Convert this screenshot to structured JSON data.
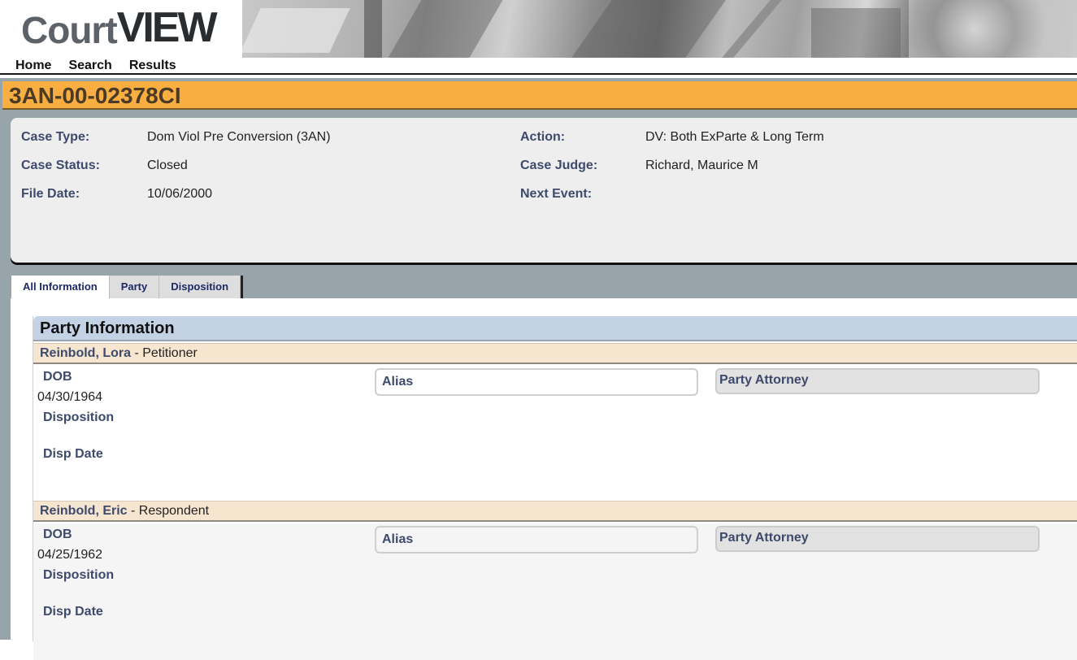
{
  "header": {
    "logo_part1": "Court",
    "logo_part2": "VIEW",
    "nav": [
      "Home",
      "Search",
      "Results"
    ]
  },
  "case": {
    "number": "3AN-00-02378CI",
    "left_fields": [
      {
        "label": "Case Type:",
        "value": "Dom Viol Pre Conversion (3AN)"
      },
      {
        "label": "Case Status:",
        "value": "Closed"
      },
      {
        "label": "File Date:",
        "value": "10/06/2000"
      }
    ],
    "right_fields": [
      {
        "label": "Action:",
        "value": "DV: Both ExParte & Long Term"
      },
      {
        "label": "Case Judge:",
        "value": "Richard, Maurice M"
      },
      {
        "label": "Next Event:",
        "value": ""
      }
    ]
  },
  "tabs": [
    {
      "label": "All Information",
      "active": true
    },
    {
      "label": "Party",
      "active": false
    },
    {
      "label": "Disposition",
      "active": false
    }
  ],
  "party_section": {
    "title": "Party Information",
    "parties": [
      {
        "name": "Reinbold, Lora",
        "role": " - Petitioner",
        "dob_label": "DOB",
        "dob": "04/30/1964",
        "disposition_label": "Disposition",
        "disposition": "",
        "disp_date_label": "Disp Date",
        "disp_date": "",
        "alias_label": "Alias",
        "attorney_label": "Party Attorney"
      },
      {
        "name": "Reinbold, Eric",
        "role": " - Respondent",
        "dob_label": "DOB",
        "dob": "04/25/1962",
        "disposition_label": "Disposition",
        "disposition": "",
        "disp_date_label": "Disp Date",
        "disp_date": "",
        "alias_label": "Alias",
        "attorney_label": "Party Attorney"
      }
    ]
  },
  "colors": {
    "case_header_bg": "#f9ae42",
    "label_color": "#3e4a6c",
    "section_title_bg": "#c3d2e5",
    "party_bar_bg": "#f6e6cf",
    "page_bg": "#97a5ab"
  }
}
